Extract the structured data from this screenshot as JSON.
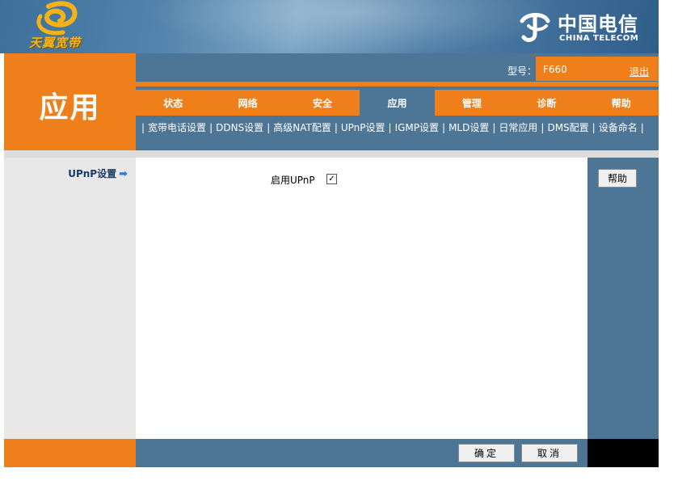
{
  "header": {
    "left_logo_text": "天翼宽带",
    "right_logo_cn": "中国电信",
    "right_logo_en": "CHINA TELECOM"
  },
  "page_title": "应用",
  "model": {
    "label": "型号：",
    "value": "F660"
  },
  "logout_label": "退出",
  "tabs": [
    {
      "label": "状态"
    },
    {
      "label": "网络"
    },
    {
      "label": "安全"
    },
    {
      "label": "应用"
    },
    {
      "label": "管理"
    },
    {
      "label": "诊断"
    },
    {
      "label": "帮助"
    }
  ],
  "active_tab": "应用",
  "subnav": [
    {
      "label": "宽带电话设置"
    },
    {
      "label": "DDNS设置"
    },
    {
      "label": "高级NAT配置"
    },
    {
      "label": "UPnP设置"
    },
    {
      "label": "IGMP设置"
    },
    {
      "label": "MLD设置"
    },
    {
      "label": "日常应用"
    },
    {
      "label": "DMS配置"
    },
    {
      "label": "设备命名"
    }
  ],
  "sidebar": {
    "item_label": "UPnP设置"
  },
  "form": {
    "enable_upnp_label": "启用UPnP",
    "enable_upnp_checked": true,
    "check_mark": "✓"
  },
  "buttons": {
    "help": "帮助",
    "ok": "确定",
    "cancel": "取消"
  },
  "colors": {
    "orange": "#ef7f1a",
    "blue": "#4d7596",
    "logo_gold": "#f6b317"
  }
}
